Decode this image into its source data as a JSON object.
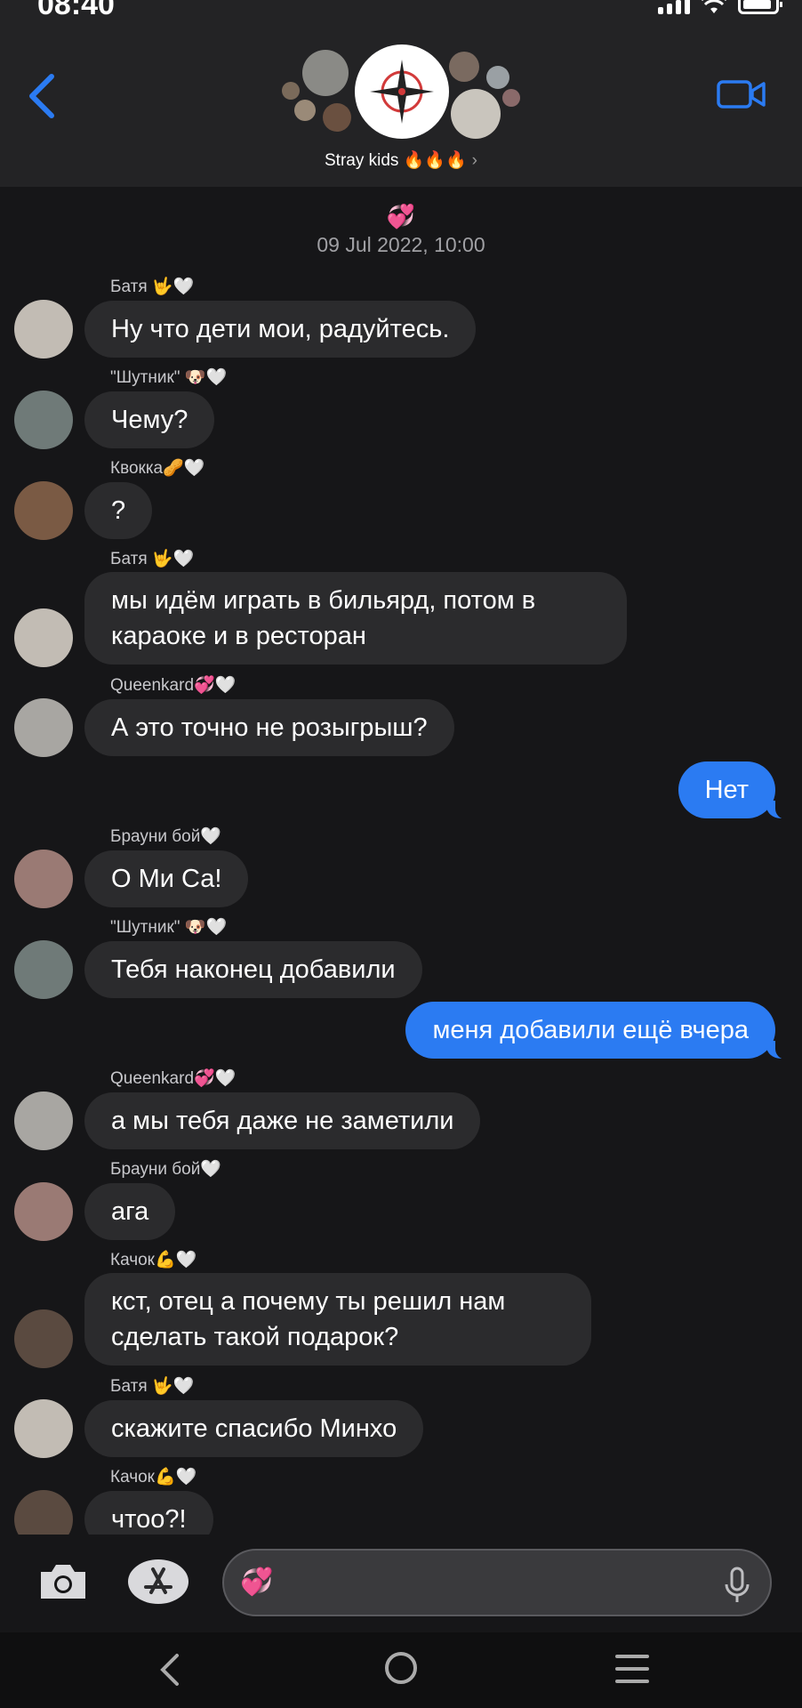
{
  "status_bar": {
    "time": "08:40"
  },
  "header": {
    "group_name": "Stray kids 🔥🔥🔥",
    "chevron": "›",
    "back_icon": "chevron-left-icon",
    "video_icon": "video-camera-icon"
  },
  "colors": {
    "accent": "#2b7bf2",
    "incoming_bubble": "#2b2b2d",
    "background": "#161618",
    "header": "#232325"
  },
  "chat": {
    "date_emoji": "💞",
    "date": "09 Jul 2022, 10:00",
    "messages": [
      {
        "dir": "in",
        "sender": "Батя 🤟🤍",
        "text": "Ну что дети мои, радуйтесь."
      },
      {
        "dir": "in",
        "sender": "\"Шутник\" 🐶🤍",
        "text": "Чему?"
      },
      {
        "dir": "in",
        "sender": "Квокка🥜🤍",
        "text": "?"
      },
      {
        "dir": "in",
        "sender": "Батя 🤟🤍",
        "text": "мы идём играть в бильярд, потом в караоке и в ресторан"
      },
      {
        "dir": "in",
        "sender": "Queenkard💞🤍",
        "text": "А это точно не розыгрыш?"
      },
      {
        "dir": "out",
        "text": "Нет"
      },
      {
        "dir": "in",
        "sender": "Брауни бой🤍",
        "text": "О Ми Са!"
      },
      {
        "dir": "in",
        "sender": "\"Шутник\" 🐶🤍",
        "text": "Тебя наконец добавили"
      },
      {
        "dir": "out",
        "text": "меня добавили ещё вчера"
      },
      {
        "dir": "in",
        "sender": "Queenkard💞🤍",
        "text": "а мы тебя даже не заметили"
      },
      {
        "dir": "in",
        "sender": "Брауни бой🤍",
        "text": "ага"
      },
      {
        "dir": "in",
        "sender": "Качок💪🤍",
        "text": "кст, отец а почему ты решил нам сделать такой подарок?"
      },
      {
        "dir": "in",
        "sender": "Батя 🤟🤍",
        "text": "скажите спасибо Минхо"
      },
      {
        "dir": "in",
        "sender": "Качок💪🤍",
        "text": "чтоо?!"
      }
    ]
  },
  "input": {
    "placeholder": "💞",
    "camera_icon": "camera-icon",
    "appstore_icon": "app-store-icon",
    "mic_icon": "microphone-icon"
  },
  "nav": {
    "back_icon": "nav-back-icon",
    "home_icon": "nav-home-icon",
    "menu_icon": "nav-recents-icon"
  }
}
